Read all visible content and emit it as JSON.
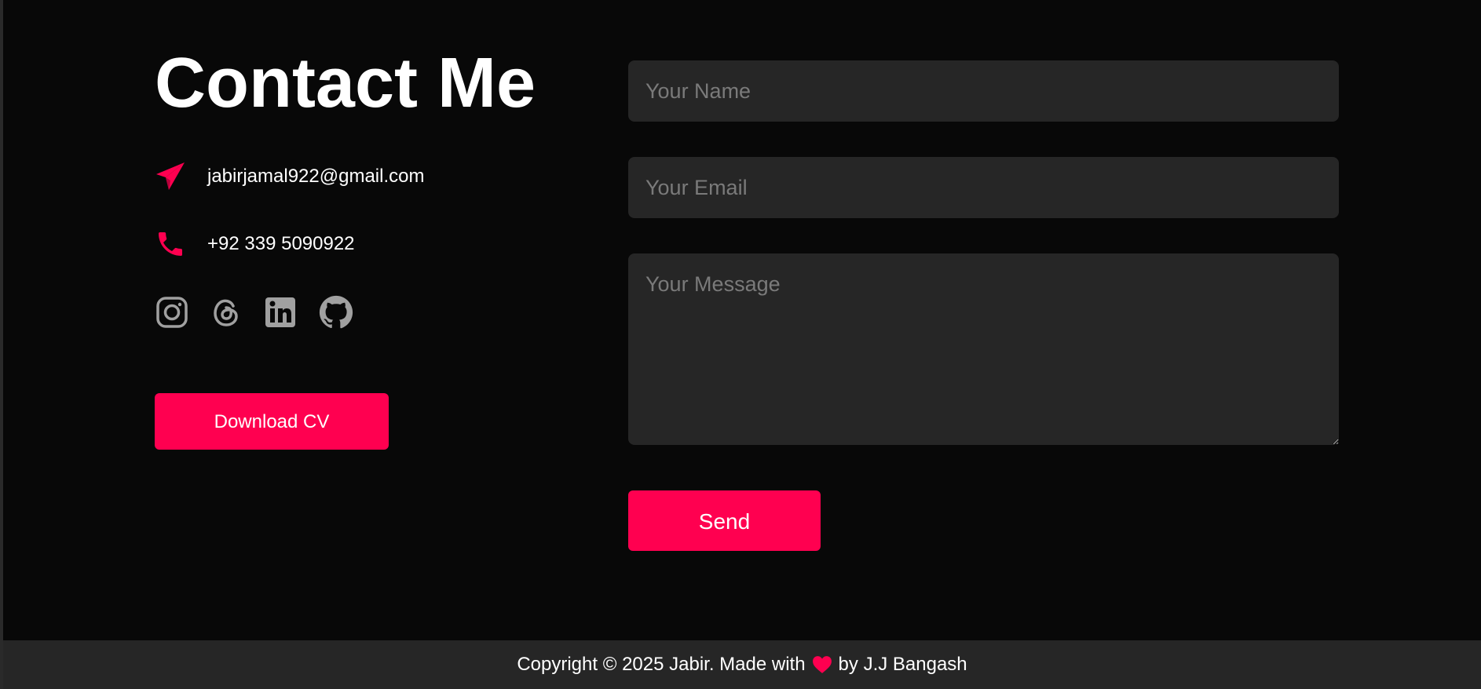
{
  "contact": {
    "title": "Contact Me",
    "email": "jabirjamal922@gmail.com",
    "phone": "+92 339 5090922",
    "email_icon": "paper-plane-icon",
    "phone_icon": "phone-icon",
    "socials": [
      "instagram-icon",
      "threads-icon",
      "linkedin-icon",
      "github-icon"
    ],
    "download_label": "Download CV"
  },
  "form": {
    "name_placeholder": "Your Name",
    "email_placeholder": "Your Email",
    "message_placeholder": "Your Message",
    "send_label": "Send"
  },
  "footer": {
    "text_before": "Copyright © 2025 Jabir. Made with",
    "heart_icon": "heart-icon",
    "text_after": "by J.J Bangash"
  },
  "colors": {
    "accent": "#ff0050",
    "background": "#080808",
    "field_background": "#262626",
    "icon_gray": "#a0a0a0"
  }
}
